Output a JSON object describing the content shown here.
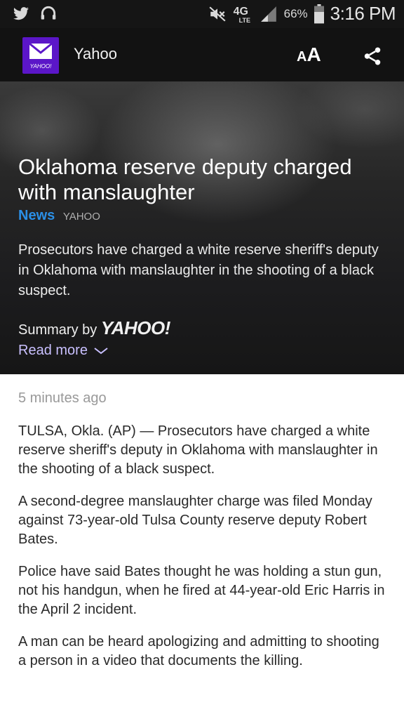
{
  "status_bar": {
    "left_icons": [
      "twitter-icon",
      "headset-icon"
    ],
    "right_icons": [
      "mute-icon",
      "4g-lte-icon",
      "signal-icon",
      "battery-icon"
    ],
    "network_label": "4G",
    "network_sub_label": "LTE",
    "battery_percent": "66%",
    "battery_level": 0.66,
    "time": "3:16 PM"
  },
  "app_bar": {
    "logo_text": "YAHOO!",
    "title": "Yahoo",
    "font_size_small": "A",
    "font_size_large": "A",
    "share_icon": "share-icon"
  },
  "hero": {
    "headline": "Oklahoma reserve deputy charged with manslaughter",
    "category": "News",
    "source": "YAHOO",
    "summary": "Prosecutors have charged a white reserve sheriff's deputy in Oklahoma with manslaughter in the shooting of a black suspect.",
    "summary_by_label": "Summary by",
    "summary_by_brand": "YAHOO!",
    "read_more": "Read more"
  },
  "article": {
    "timestamp": "5 minutes ago",
    "paragraphs": [
      "TULSA, Okla. (AP) — Prosecutors have charged a white reserve sheriff's deputy in Oklahoma with manslaughter in the shooting of a black suspect.",
      "A second-degree manslaughter charge was filed Monday against 73-year-old Tulsa County reserve deputy Robert Bates.",
      "Police have said Bates thought he was holding a stun gun, not his handgun, when he fired at 44-year-old Eric Harris in the April 2 incident.",
      "A man can be heard apologizing and admitting to shooting a person in a video that documents the killing."
    ]
  },
  "colors": {
    "brand_purple": "#5b16c8",
    "category_blue": "#2b8fe6",
    "read_more": "#c9c0ff"
  }
}
